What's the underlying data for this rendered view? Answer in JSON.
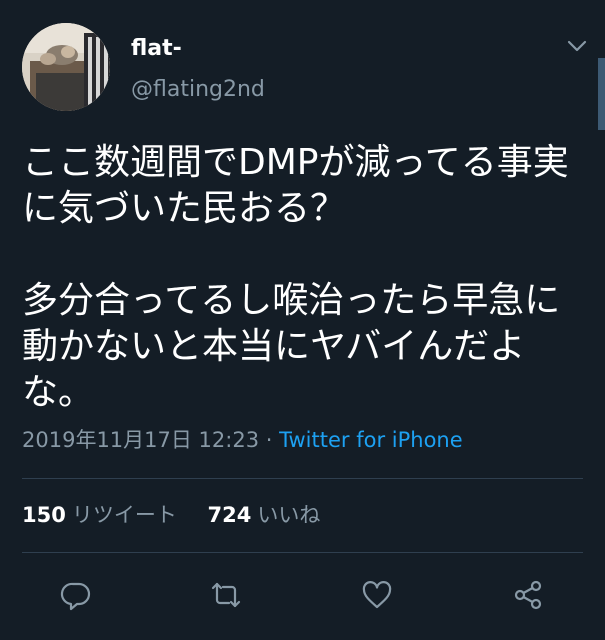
{
  "tweet": {
    "author": {
      "display_name": "flat-",
      "handle": "@flating2nd",
      "avatar_icon": "avatar-photo"
    },
    "text_paragraphs": [
      "ここ数週間でDMPが減ってる事実に気づいた民おる？",
      "多分合ってるし喉治ったら早急に動かないと本当にヤバイんだよな。"
    ],
    "timestamp": "2019年11月17日 12:23",
    "separator": "·",
    "source": "Twitter for iPhone",
    "stats": {
      "retweets_count": "150",
      "retweets_label": "リツイート",
      "likes_count": "724",
      "likes_label": "いいね"
    },
    "actions": [
      {
        "name": "reply",
        "icon": "reply-icon"
      },
      {
        "name": "retweet",
        "icon": "retweet-icon"
      },
      {
        "name": "like",
        "icon": "heart-icon"
      },
      {
        "name": "share",
        "icon": "share-icon"
      }
    ]
  },
  "colors": {
    "background": "#141d26",
    "text_primary": "#ffffff",
    "text_secondary": "#8899a6",
    "link": "#1da1f2",
    "divider": "#2f3f4f"
  }
}
